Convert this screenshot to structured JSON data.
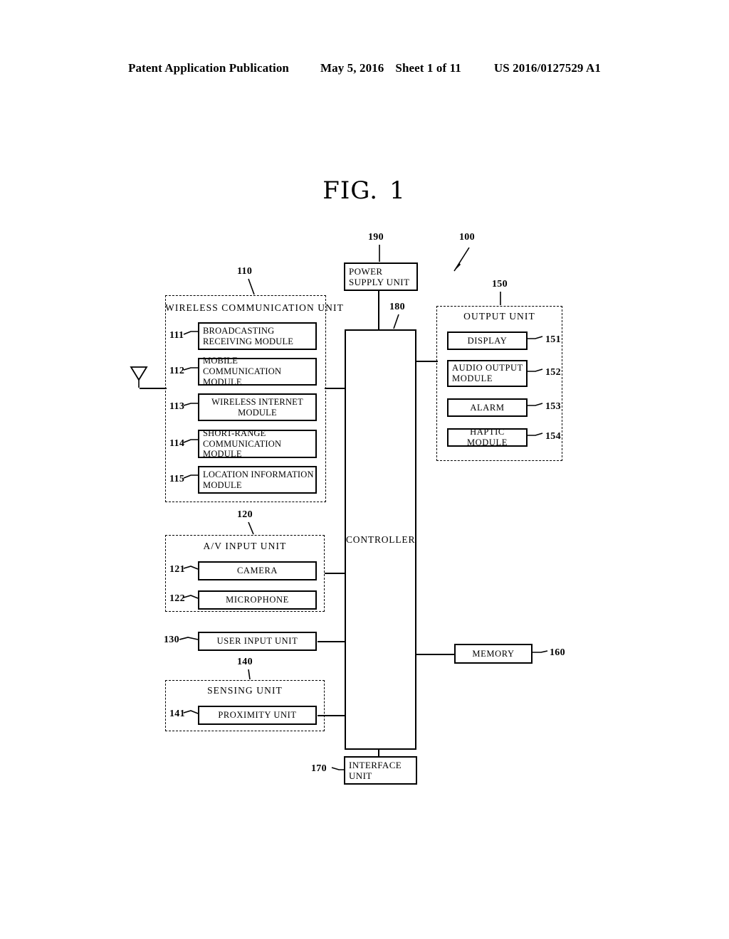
{
  "header": {
    "publication": "Patent Application Publication",
    "date": "May 5, 2016",
    "sheet": "Sheet 1 of 11",
    "number": "US 2016/0127529 A1"
  },
  "figure": {
    "label": "FIG.",
    "number": "1",
    "device_ref": "100"
  },
  "blocks": {
    "power_supply": {
      "label": "POWER SUPPLY UNIT",
      "ref": "190"
    },
    "controller": {
      "label": "CONTROLLER",
      "ref": "180"
    },
    "memory": {
      "label": "MEMORY",
      "ref": "160"
    },
    "interface": {
      "label": "INTERFACE UNIT",
      "ref": "170"
    },
    "user_input": {
      "label": "USER INPUT UNIT",
      "ref": "130"
    }
  },
  "groups": {
    "wireless": {
      "title": "WIRELESS COMMUNICATION UNIT",
      "ref": "110",
      "items": [
        {
          "label": "BROADCASTING RECEIVING MODULE",
          "ref": "111"
        },
        {
          "label": "MOBILE COMMUNICATION MODULE",
          "ref": "112"
        },
        {
          "label": "WIRELESS INTERNET MODULE",
          "ref": "113"
        },
        {
          "label": "SHORT-RANGE COMMUNICATION MODULE",
          "ref": "114"
        },
        {
          "label": "LOCATION INFORMATION MODULE",
          "ref": "115"
        }
      ]
    },
    "output": {
      "title": "OUTPUT UNIT",
      "ref": "150",
      "items": [
        {
          "label": "DISPLAY",
          "ref": "151"
        },
        {
          "label": "AUDIO OUTPUT MODULE",
          "ref": "152"
        },
        {
          "label": "ALARM",
          "ref": "153"
        },
        {
          "label": "HAPTIC MODULE",
          "ref": "154"
        }
      ]
    },
    "av_input": {
      "title": "A/V INPUT UNIT",
      "ref": "120",
      "items": [
        {
          "label": "CAMERA",
          "ref": "121"
        },
        {
          "label": "MICROPHONE",
          "ref": "122"
        }
      ]
    },
    "sensing": {
      "title": "SENSING UNIT",
      "ref": "140",
      "items": [
        {
          "label": "PROXIMITY UNIT",
          "ref": "141"
        }
      ]
    }
  },
  "icons": {
    "antenna": "antenna-icon"
  }
}
